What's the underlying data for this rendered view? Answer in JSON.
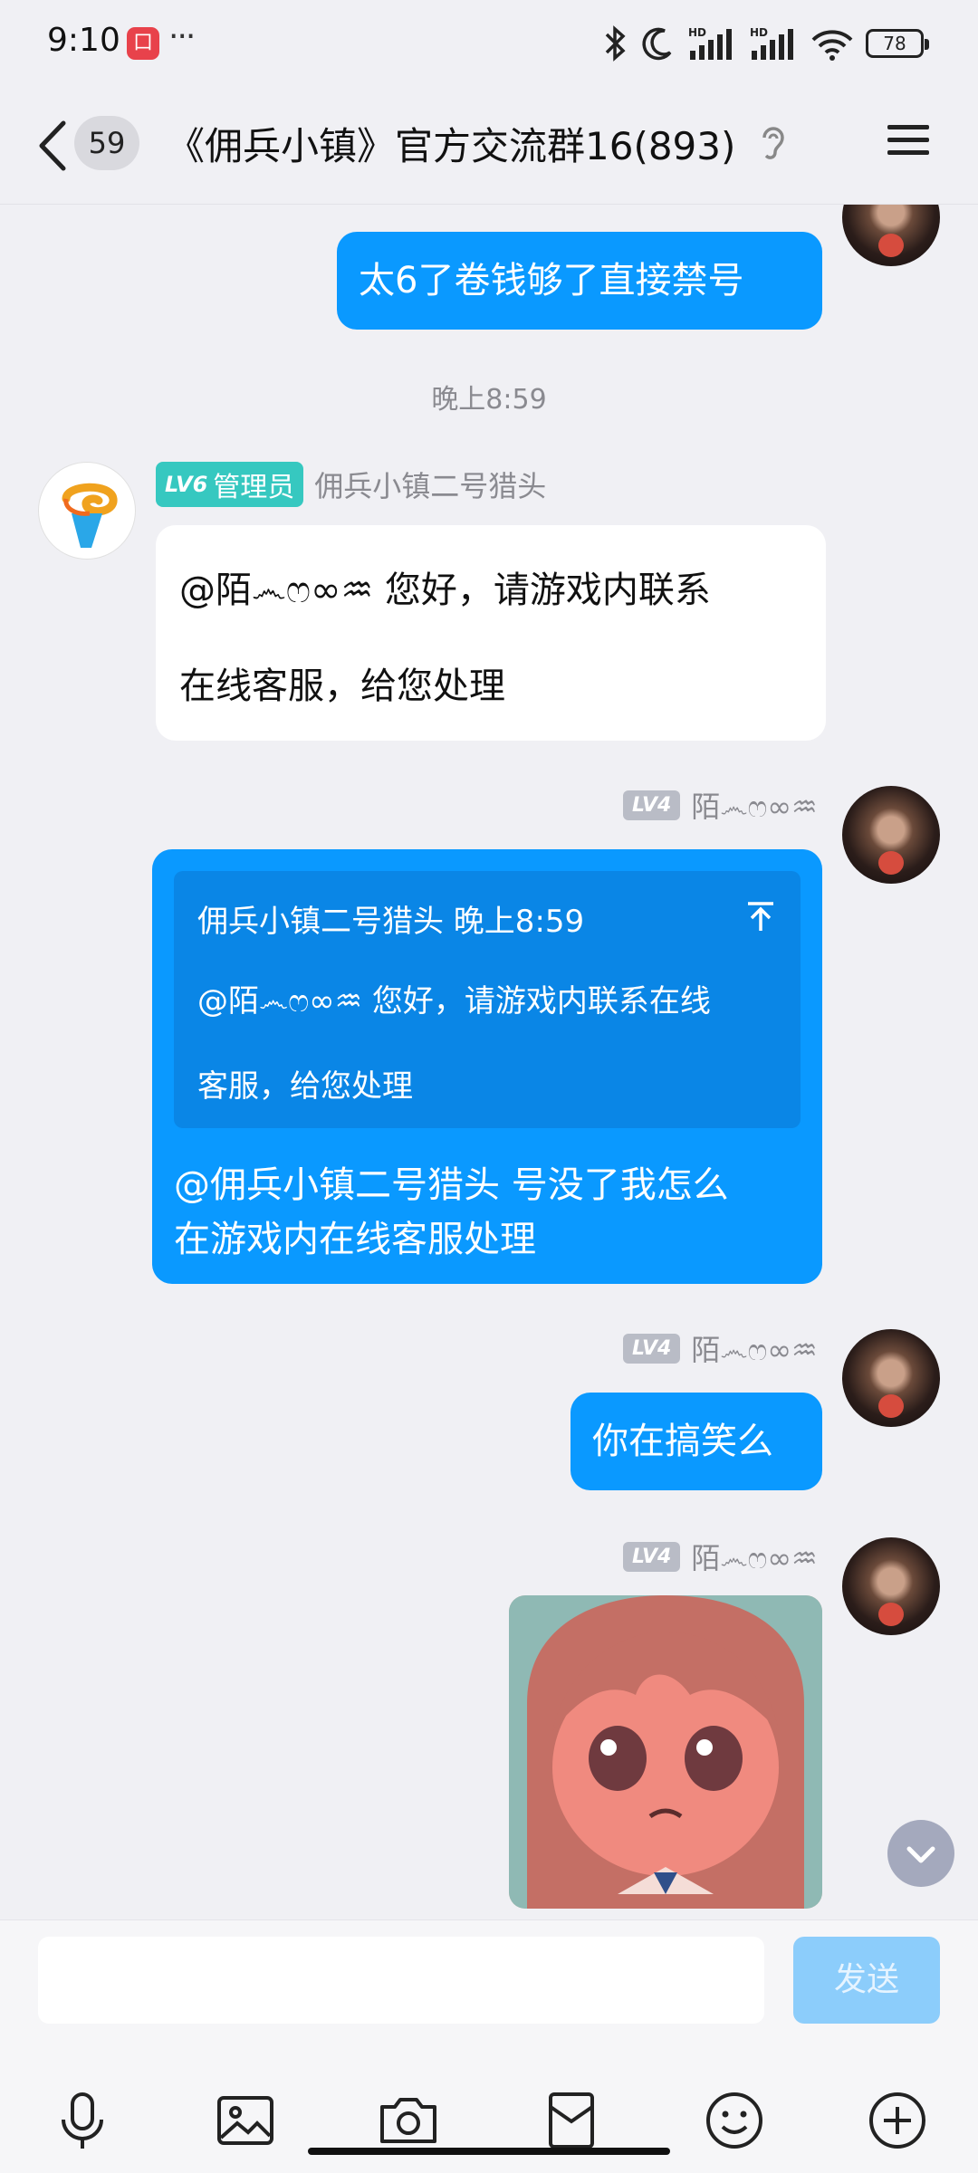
{
  "status_bar": {
    "time": "9:10",
    "notif_badge": "口",
    "more": "···",
    "battery": "78"
  },
  "header": {
    "unread_count": "59",
    "title": "《佣兵小镇》官方交流群16(893)"
  },
  "messages": {
    "msg1_text": "太6了卷钱够了直接禁号",
    "divider_time": "晚上8:59",
    "admin": {
      "level": "LV6",
      "role": "管理员",
      "name": "佣兵小镇二号猎头",
      "line1": "@陌෴ෆ∞♒ 您好，请游戏内联系",
      "line2": "在线客服，给您处理"
    },
    "user": {
      "level": "LV4",
      "name": "陌෴ෆ∞♒"
    },
    "reply": {
      "quote_header": "佣兵小镇二号猎头 晚上8:59",
      "quote_line1": "@陌෴ෆ∞♒ 您好，请游戏内联系在线",
      "quote_line2": "客服，给您处理",
      "line1": "@佣兵小镇二号猎头 号没了我怎么",
      "line2": "在游戏内在线客服处理"
    },
    "msg4_text": "你在搞笑么"
  },
  "input": {
    "placeholder": "",
    "send_label": "发送"
  },
  "colors": {
    "accent_blue": "#0a99ff",
    "admin_badge": "#36c8c0"
  }
}
